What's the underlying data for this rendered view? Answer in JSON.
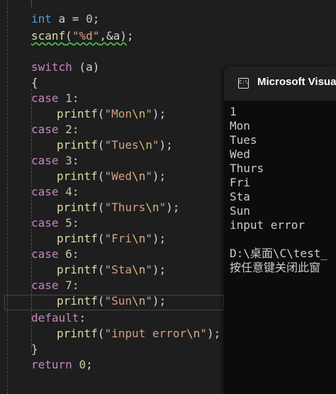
{
  "code": {
    "l1": {
      "kw": "int",
      "rest": " a = ",
      "num": "0",
      "end": ";"
    },
    "l2": {
      "fn": "scanf",
      "open": "(",
      "str": "\"%d\"",
      "rest": ",&a)",
      "end": ";"
    },
    "l3": {
      "kw": "switch",
      "rest": " (a)"
    },
    "l4": {
      "brace": "{"
    },
    "cases": [
      {
        "kw": "case",
        "num": "1",
        "str": "\"Mon",
        "esc": "\\n",
        "q": "\""
      },
      {
        "kw": "case",
        "num": "2",
        "str": "\"Tues",
        "esc": "\\n",
        "q": "\""
      },
      {
        "kw": "case",
        "num": "3",
        "str": "\"Wed",
        "esc": "\\n",
        "q": "\""
      },
      {
        "kw": "case",
        "num": "4",
        "str": "\"Thurs",
        "esc": "\\n",
        "q": "\""
      },
      {
        "kw": "case",
        "num": "5",
        "str": "\"Fri",
        "esc": "\\n",
        "q": "\""
      },
      {
        "kw": "case",
        "num": "6",
        "str": "\"Sta",
        "esc": "\\n",
        "q": "\""
      },
      {
        "kw": "case",
        "num": "7",
        "str": "\"Sun",
        "esc": "\\n",
        "q": "\""
      }
    ],
    "printf": "printf",
    "default_kw": "default",
    "default_str": "\"input error",
    "default_esc": "\\n",
    "close_brace": "}",
    "return_kw": "return",
    "return_num": "0"
  },
  "console": {
    "title": "Microsoft Visual",
    "icon_label": "C:\\",
    "lines": [
      "1",
      "Mon",
      "Tues",
      "Wed",
      "Thurs",
      "Fri",
      "Sta",
      "Sun",
      "input error",
      "",
      "D:\\桌面\\C\\test_",
      "按任意键关闭此窗"
    ]
  },
  "colors": {
    "keyword": "#569cd6",
    "control": "#c586c0",
    "function": "#dcdcaa",
    "string": "#d69d85",
    "number": "#b5cea8"
  }
}
